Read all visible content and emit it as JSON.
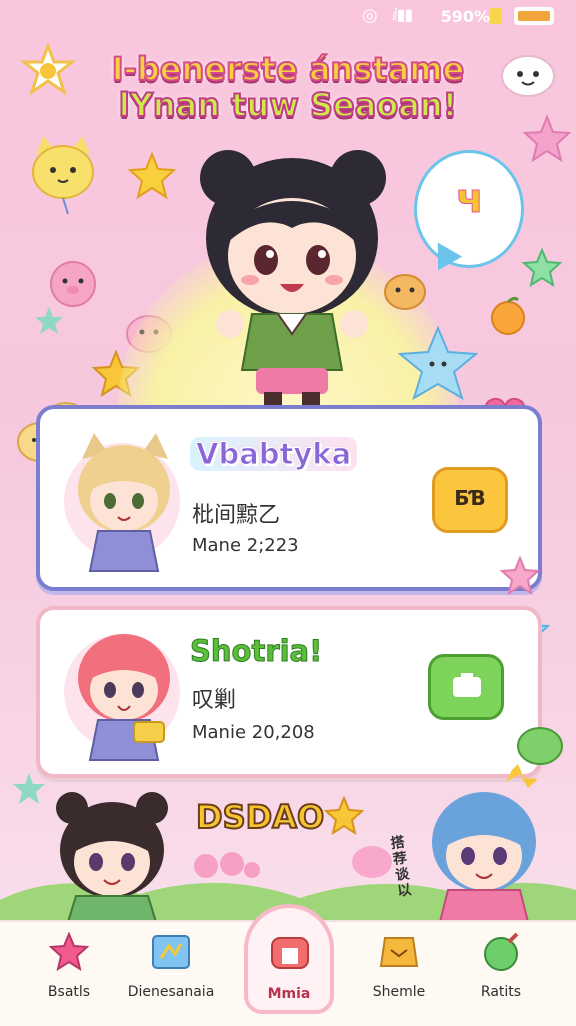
{
  "status_bar": {
    "text": "590%"
  },
  "header": {
    "title_line1": "I-benerste ánstame",
    "title_line2": "lYnan tuw Seaoan!"
  },
  "hero": {
    "speech_text": "ч"
  },
  "cards": [
    {
      "name": "Vbabtyka",
      "subtitle": "枇间黥乙",
      "meta": "Mane 2;223",
      "action_label": "ƂƁ"
    },
    {
      "name": "Shotria!",
      "subtitle": "叹剿",
      "meta": "Manie 20,208",
      "action_label": ""
    }
  ],
  "bottom": {
    "banner": "DSDAO",
    "side_text": "搭 荐 谈 以"
  },
  "nav": {
    "items": [
      {
        "label": "Bsatls",
        "icon": "star-icon"
      },
      {
        "label": "Dienesanaia",
        "icon": "map-icon"
      },
      {
        "label": "Mmia",
        "icon": "home-icon"
      },
      {
        "label": "Shemle",
        "icon": "chest-icon"
      },
      {
        "label": "Ratits",
        "icon": "potion-icon"
      }
    ]
  },
  "colors": {
    "background": "#f9c6dd",
    "accent": "#f5c531",
    "card1_border": "#7b7ed0",
    "card2_border": "#f2b7c6"
  }
}
